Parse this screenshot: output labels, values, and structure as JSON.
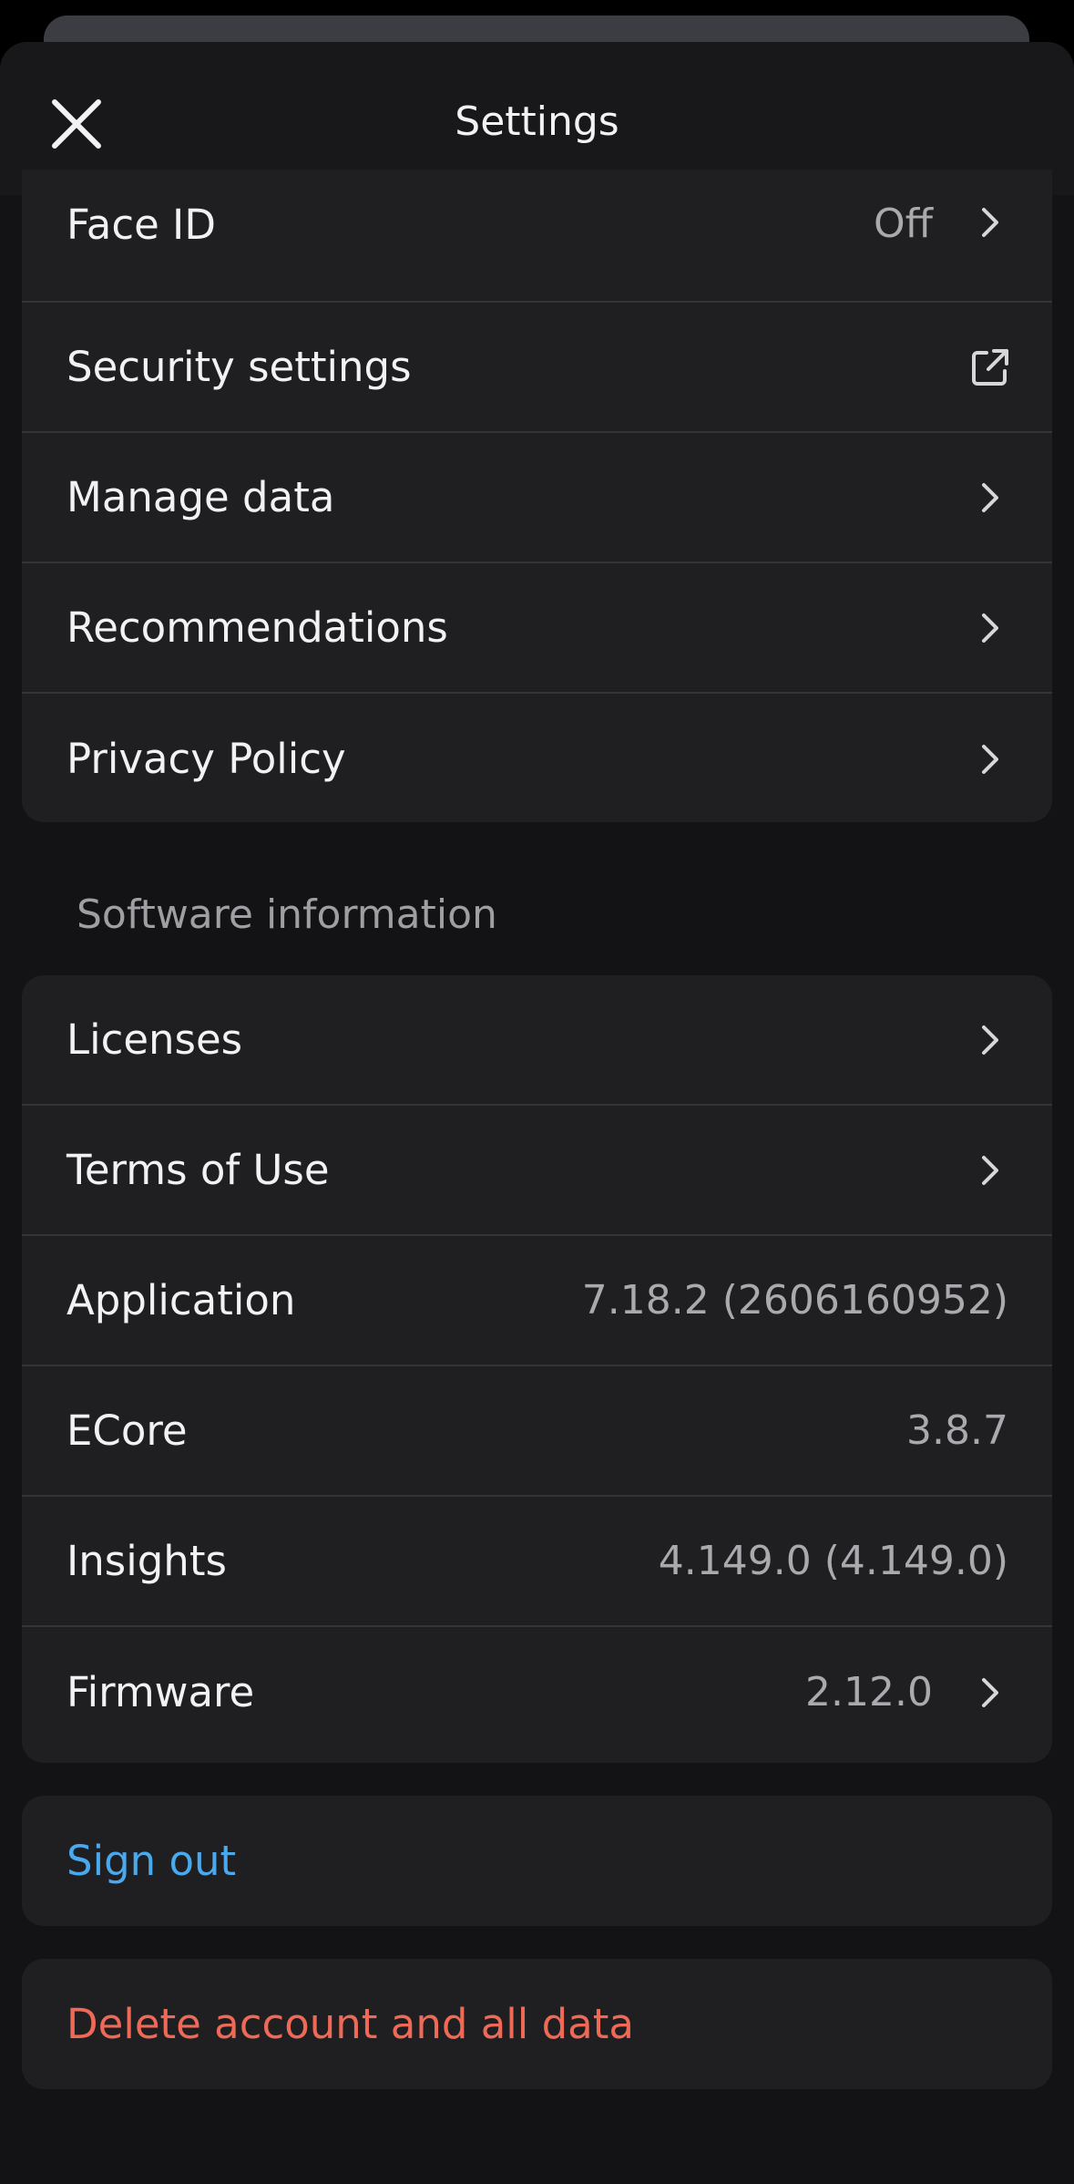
{
  "header": {
    "title": "Settings"
  },
  "security_group": {
    "face_id": {
      "label": "Face ID",
      "value": "Off"
    },
    "security_settings": {
      "label": "Security settings"
    },
    "manage_data": {
      "label": "Manage data"
    },
    "recommendations": {
      "label": "Recommendations"
    },
    "privacy_policy": {
      "label": "Privacy Policy"
    }
  },
  "software_section": {
    "title": "Software information",
    "licenses": {
      "label": "Licenses"
    },
    "terms": {
      "label": "Terms of Use"
    },
    "application": {
      "label": "Application",
      "value": "7.18.2 (2606160952)"
    },
    "ecore": {
      "label": "ECore",
      "value": "3.8.7"
    },
    "insights": {
      "label": "Insights",
      "value": "4.149.0 (4.149.0)"
    },
    "firmware": {
      "label": "Firmware",
      "value": "2.12.0"
    }
  },
  "actions": {
    "sign_out": "Sign out",
    "delete_account": "Delete account and all data"
  },
  "colors": {
    "link_blue": "#4aa8ec",
    "danger_red": "#ee6a57",
    "card_bg": "#1f1f22",
    "sheet_bg": "#131315"
  },
  "icons": {
    "close": "close-icon",
    "chevron": "chevron-right-icon",
    "external": "external-link-icon"
  }
}
